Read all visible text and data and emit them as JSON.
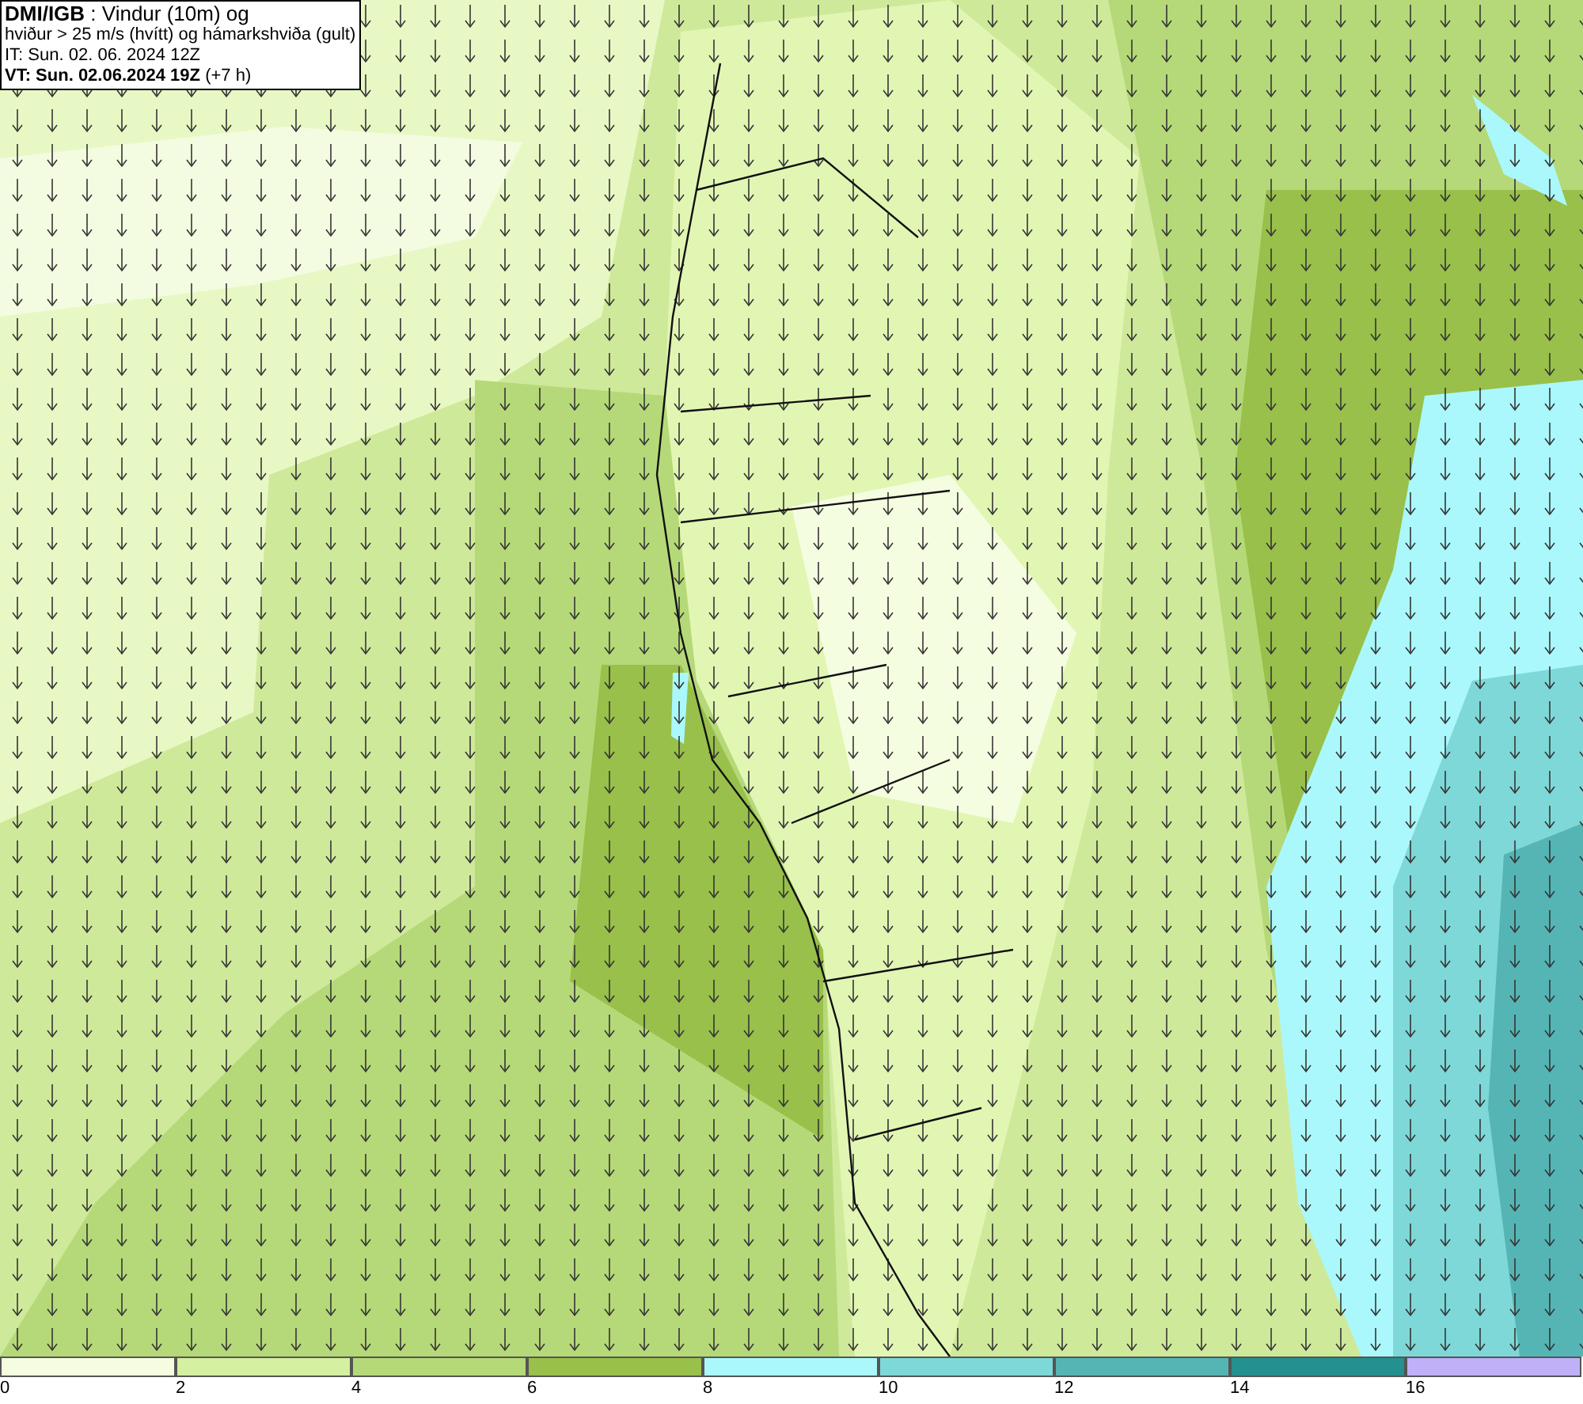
{
  "header": {
    "lines": [
      "**DMI/IGB** : Vindur (10m) og",
      "hviður > 25 m/s (hvítt) og hámarkshviða (gult)",
      "IT: Sun. 02. 06. 2024 12Z",
      "**VT: Sun. 02.06.2024 19Z** (+7 h)"
    ]
  },
  "legend": [
    {
      "color": "#f5fde0",
      "label": "0"
    },
    {
      "color": "#d4f0a0",
      "label": "2"
    },
    {
      "color": "#b5d978",
      "label": "4"
    },
    {
      "color": "#98c04a",
      "label": "6"
    },
    {
      "color": "#aaf8fc",
      "label": "8"
    },
    {
      "color": "#7fd8d8",
      "label": "10"
    },
    {
      "color": "#55b5b5",
      "label": "12"
    },
    {
      "color": "#249090",
      "label": "14"
    },
    {
      "color": "#c0b0f8",
      "label": "16"
    }
  ]
}
